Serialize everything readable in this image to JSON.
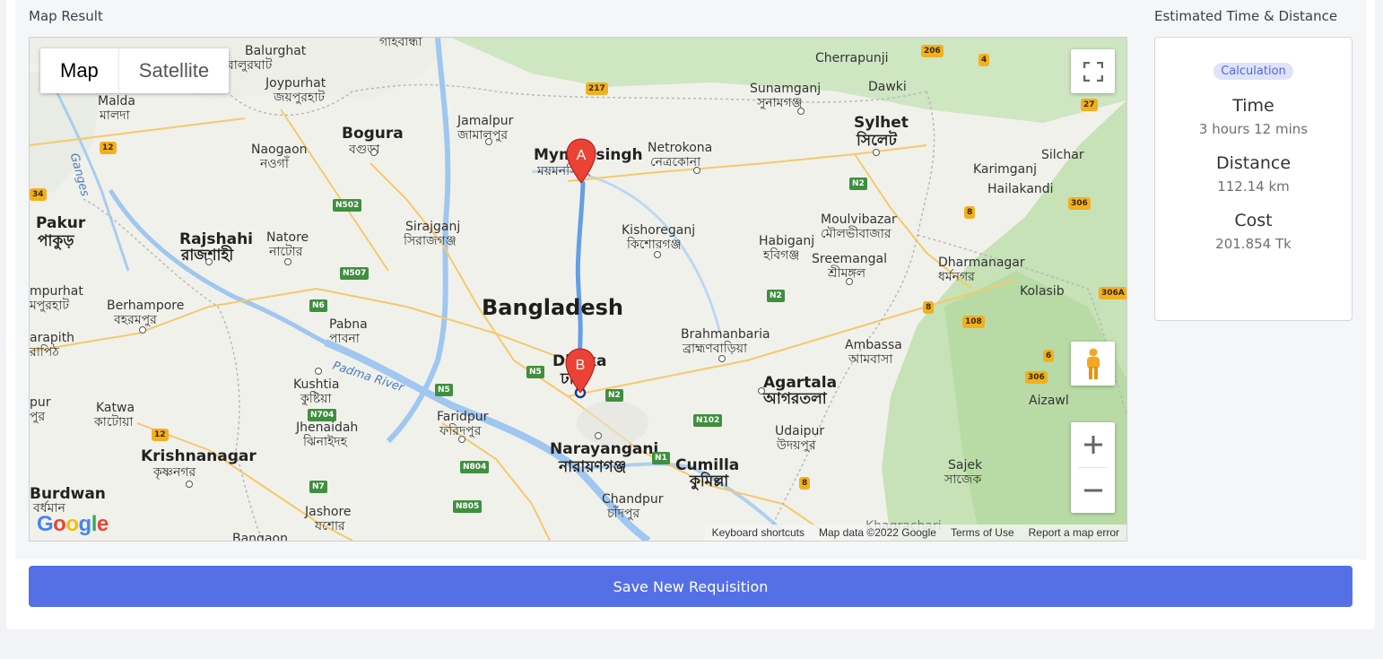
{
  "sections": {
    "map_result_label": "Map Result",
    "estimate_label": "Estimated Time & Distance"
  },
  "map": {
    "type_map": "Map",
    "type_satellite": "Satellite",
    "attribution": {
      "keyboard": "Keyboard shortcuts",
      "data": "Map data ©2022 Google",
      "terms": "Terms of Use",
      "report": "Report a map error"
    },
    "logo": "Google",
    "marker_a": "A",
    "marker_b": "B",
    "labels": {
      "country": "Bangladesh",
      "mymensingh": "Mymensingh",
      "mymensingh_bn": "ময়মনসিংহ",
      "dhaka": "Dhaka",
      "dhaka_bn": "ঢাকা",
      "jamalpur": "Jamalpur",
      "jamalpur_bn": "জামালপুর",
      "netrokona": "Netrokona",
      "netrokona_bn": "নেত্রকোনা",
      "kishoreganj": "Kishoreganj",
      "kishoreganj_bn": "কিশোরগঞ্জ",
      "bogura": "Bogura",
      "bogura_bn": "বগুড়া",
      "naogaon": "Naogaon",
      "naogaon_bn": "নওগাঁ",
      "joypurhat": "Joypurhat",
      "joypurhat_bn": "জয়পুরহাট",
      "balurghat": "Balurghat",
      "balurghat_bn": "বালুরঘাট",
      "malda": "Malda",
      "malda_bn": "মালদা",
      "pakur": "Pakur",
      "pakur_bn": "পাকুড়",
      "rajshahi": "Rajshahi",
      "rajshahi_bn": "রাজশাহী",
      "natore": "Natore",
      "natore_bn": "নাটোর",
      "sirajganj": "Sirajganj",
      "sirajganj_bn": "সিরাজগঞ্জ",
      "pabna": "Pabna",
      "pabna_bn": "পাবনা",
      "berhampore": "Berhampore",
      "berhampore_bn": "বহরমপুর",
      "jangipur": "mpurhat",
      "jangipur_bn": "মপুরহাট",
      "kushtia": "Kushtia",
      "kushtia_bn": "কুষ্টিয়া",
      "jhenaidah": "Jhenaidah",
      "jhenaidah_bn": "ঝিনাইদহ",
      "faridpur": "Faridpur",
      "faridpur_bn": "ফরিদপুর",
      "narayanganj": "Narayanganj",
      "narayanganj_bn": "নারায়ণগঞ্জ",
      "cumilla": "Cumilla",
      "cumilla_bn": "কুমিল্লা",
      "chandpur": "Chandpur",
      "chandpur_bn": "চাঁদপুর",
      "jashore": "Jashore",
      "jashore_bn": "যশোর",
      "krishnanagar": "Krishnanagar",
      "krishnanagar_bn": "কৃষ্ণনগর",
      "katwa": "Katwa",
      "katwa_bn": "কাটোয়া",
      "burdwan": "Burdwan",
      "burdwan_bn": "বর্ধমান",
      "bangaon": "Bangaon",
      "sylhet": "Sylhet",
      "sylhet_bn": "সিলেট",
      "sunamganj": "Sunamganj",
      "sunamganj_bn": "সুনামগঞ্জ",
      "cherrapunji": "Cherrapunji",
      "dawki": "Dawki",
      "moulvibazar": "Moulvibazar",
      "moulvibazar_bn": "মৌলভীবাজার",
      "habiganj": "Habiganj",
      "habiganj_bn": "হবিগঞ্জ",
      "sreemangal": "Sreemangal",
      "sreemangal_bn": "শ্রীমঙ্গল",
      "brahmanbaria": "Brahmanbaria",
      "brahmanbaria_bn": "ব্রাহ্মণবাড়িয়া",
      "agartala": "Agartala",
      "agartala_bn": "আগরতলা",
      "udaipur": "Udaipur",
      "udaipur_bn": "উদয়পুর",
      "ambassa": "Ambassa",
      "ambassa_bn": "আমবাসা",
      "dharmanagar": "Dharmanagar",
      "dharmanagar_bn": "ধর্মনগর",
      "karimganj": "Karimganj",
      "hailakandi": "Hailakandi",
      "silchar": "Silchar",
      "kolasib": "Kolasib",
      "aizawl": "Aizawl",
      "sajek": "Sajek",
      "sajek_bn": "সাজেক",
      "khagrachari": "Khagrachari",
      "gaibandha_bn": "গাইবান্ধা",
      "padma": "Padma River",
      "ganges": "Ganges",
      "arampur": "arapith",
      "arampur_bn": "রাপিঠ",
      "pur": "pur",
      "pur_bn": "পুর"
    },
    "highways": {
      "n502": "N502",
      "n507": "N507",
      "n6": "N6",
      "n5a": "N5",
      "n5b": "N5",
      "n704": "N704",
      "n804": "N804",
      "n7": "N7",
      "n805": "N805",
      "n2a": "N2",
      "n2b": "N2",
      "n2c": "N2",
      "n102": "N102",
      "n1": "N1",
      "h217": "217",
      "h206": "206",
      "h4": "4",
      "h27": "27",
      "h8a": "8",
      "h306": "306",
      "h306a": "306A",
      "h108": "108",
      "h8b": "8",
      "h6": "6",
      "h306b": "306",
      "h8c": "8",
      "h12a": "12",
      "h12b": "12",
      "h34": "34"
    }
  },
  "estimate": {
    "badge": "Calculation",
    "time_label": "Time",
    "time_value": "3 hours 12 mins",
    "distance_label": "Distance",
    "distance_value": "112.14 km",
    "cost_label": "Cost",
    "cost_value": "201.854 Tk"
  },
  "actions": {
    "save_label": "Save New Requisition"
  },
  "colors": {
    "accent": "#5570e6",
    "route": "#4a90e2",
    "marker": "#ea4335"
  }
}
